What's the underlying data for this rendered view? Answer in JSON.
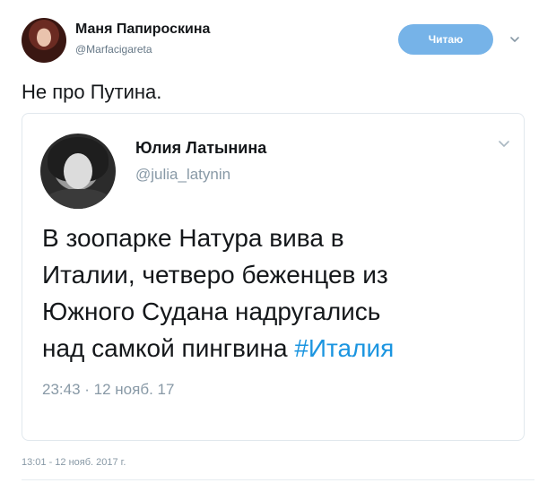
{
  "author": {
    "name": "Маня Папироскина",
    "handle": "@Marfacigareta"
  },
  "follow_button": {
    "label": "Читаю",
    "color": "#76b3e8"
  },
  "tweet": {
    "text": "Не про Путина.",
    "timestamp": "13:01 - 12 нояб. 2017 г."
  },
  "quoted_tweet": {
    "name": "Юлия Латынина",
    "handle": "@julia_latynin",
    "line1": "В зоопарке Натура вива в",
    "line2": "Италии, четверо беженцев из",
    "line3": "Южного Судана надругались",
    "line4_text": "над самкой пингвина ",
    "hashtag": "#Италия",
    "time": "23:43 · 12 нояб. 17",
    "hashtag_color": "#1b95e0"
  },
  "icons": {
    "more": "chevron-down-icon"
  }
}
